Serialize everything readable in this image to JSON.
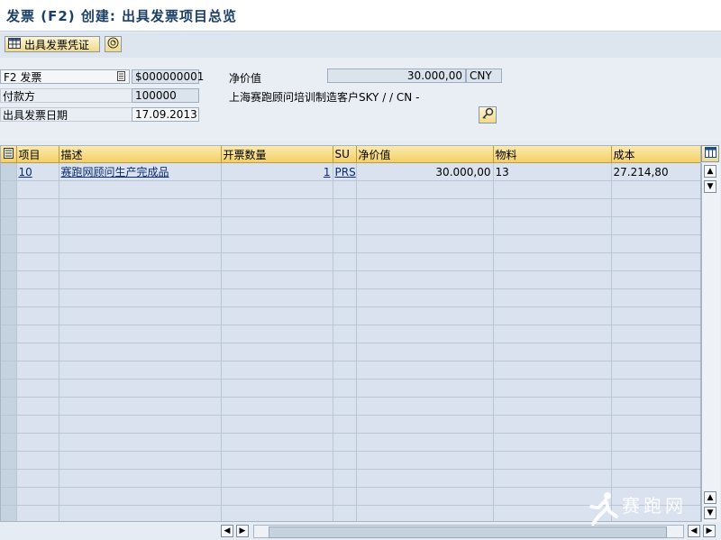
{
  "title": "发票 (F2) 创建: 出具发票项目总览",
  "toolbar": {
    "issue_voucher_label": "出具发票凭证"
  },
  "header": {
    "billing_type_value": "F2 发票",
    "billing_doc_number": "$000000001",
    "payer_label": "付款方",
    "payer_value": "100000",
    "billing_date_label": "出具发票日期",
    "billing_date_value": "17.09.2013",
    "net_value_label": "净价值",
    "net_value_value": "30.000,00",
    "currency_value": "CNY",
    "payer_name": "上海赛跑顾问培训制造客户SKY /  / CN -"
  },
  "table": {
    "columns": [
      "项目",
      "描述",
      "开票数量",
      "SU",
      "净价值",
      "物料",
      "成本"
    ],
    "rows": [
      [
        "10",
        "赛跑网顾问生产完成品",
        "1",
        "PRS",
        "30.000,00",
        "13",
        "27.214,80"
      ]
    ],
    "empty_rows": 19
  },
  "icons": {
    "voucher": "table-icon",
    "environment": "circle-icon",
    "detail": "key-icon",
    "column_config": "columns-icon",
    "select_all": "select-all-icon"
  },
  "watermark": {
    "brand": "赛跑网"
  },
  "colors": {
    "title_text": "#1c3f66",
    "grid_header": "#f3cf66",
    "grid_body": "#d9e2ee",
    "link": "#0a2c73"
  }
}
